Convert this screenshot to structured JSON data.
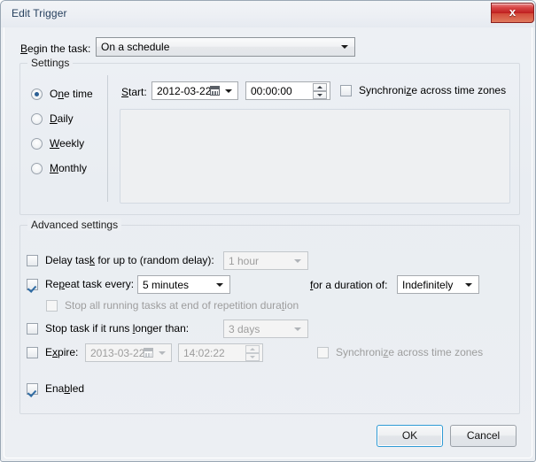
{
  "window": {
    "title": "Edit Trigger",
    "close_label": "x"
  },
  "begin": {
    "label": "Begin the task:",
    "value": "On a schedule"
  },
  "settings": {
    "legend": "Settings",
    "radios": [
      {
        "label": "One time",
        "checked": true
      },
      {
        "label": "Daily",
        "checked": false
      },
      {
        "label": "Weekly",
        "checked": false
      },
      {
        "label": "Monthly",
        "checked": false
      }
    ],
    "start_label": "Start:",
    "start_date": "2012-03-22",
    "start_time": "00:00:00",
    "sync_label": "Synchronize across time zones",
    "sync_checked": false
  },
  "advanced": {
    "legend": "Advanced settings",
    "delay": {
      "label": "Delay task for up to (random delay):",
      "checked": false,
      "value": "1 hour",
      "enabled": false
    },
    "repeat": {
      "label": "Repeat task every:",
      "checked": true,
      "value": "5 minutes",
      "enabled": true,
      "duration_label": "for a duration of:",
      "duration_value": "Indefinitely"
    },
    "stop_all": {
      "label": "Stop all running tasks at end of repetition duration",
      "checked": false,
      "enabled": false
    },
    "stop_longer": {
      "label": "Stop task if it runs longer than:",
      "checked": false,
      "value": "3 days",
      "enabled": false
    },
    "expire": {
      "label": "Expire:",
      "checked": false,
      "date": "2013-03-22",
      "time": "14:02:22",
      "sync_label": "Synchronize across time zones",
      "sync_checked": false
    },
    "enabled_row": {
      "label": "Enabled",
      "checked": true
    }
  },
  "footer": {
    "ok_label": "OK",
    "cancel_label": "Cancel"
  }
}
